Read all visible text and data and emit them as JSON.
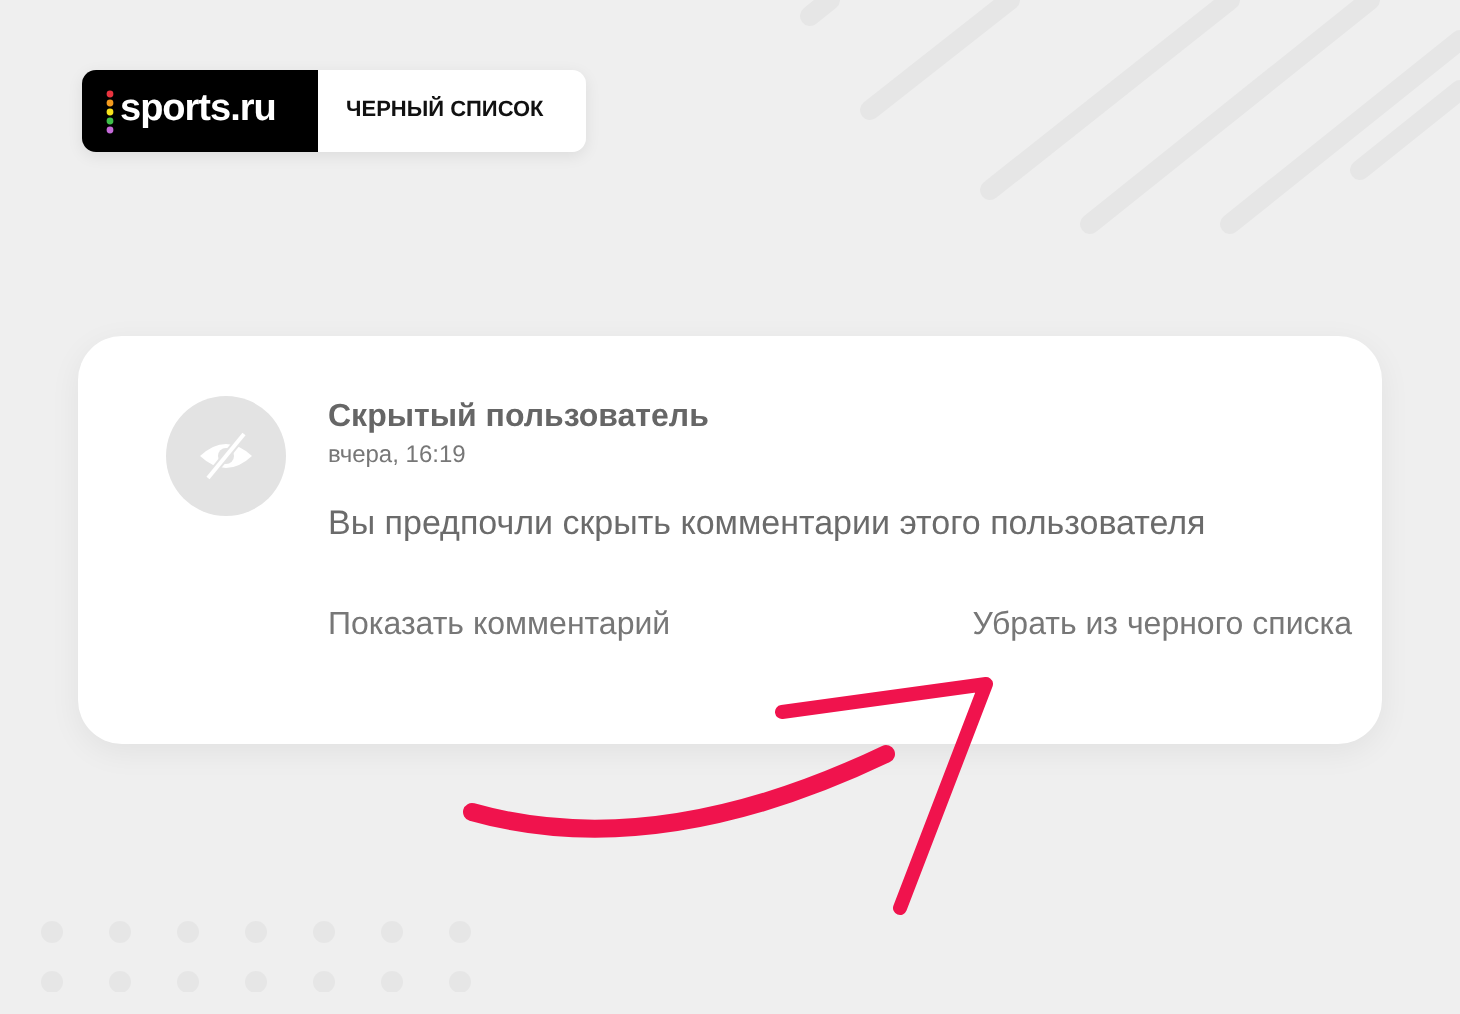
{
  "header": {
    "logo": "sports.ru",
    "section": "ЧЕРНЫЙ СПИСОК"
  },
  "comment": {
    "author": "Скрытый пользователь",
    "time": "вчера, 16:19",
    "message": "Вы предпочли скрыть комментарии этого пользователя",
    "actions": [
      "Показать комментарий",
      "Убрать из черного списка"
    ]
  }
}
